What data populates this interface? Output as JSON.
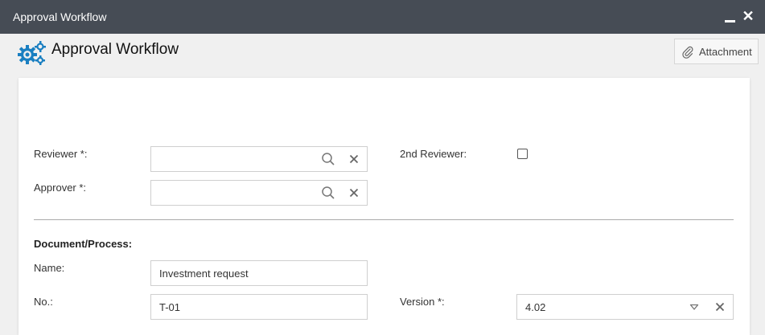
{
  "window": {
    "title": "Approval Workflow"
  },
  "header": {
    "title": "Approval Workflow",
    "attachment_label": "Attachment"
  },
  "form": {
    "reviewer_label": "Reviewer *:",
    "reviewer_value": "",
    "second_reviewer_label": "2nd Reviewer:",
    "second_reviewer_checked": false,
    "approver_label": "Approver *:",
    "approver_value": "",
    "section_title": "Document/Process:",
    "name_label": "Name:",
    "name_value": "Investment request",
    "no_label": "No.:",
    "no_value": "T-01",
    "version_label": "Version *:",
    "version_value": "4.02"
  },
  "colors": {
    "titlebar": "#464c55",
    "accent": "#1a7fc1"
  }
}
